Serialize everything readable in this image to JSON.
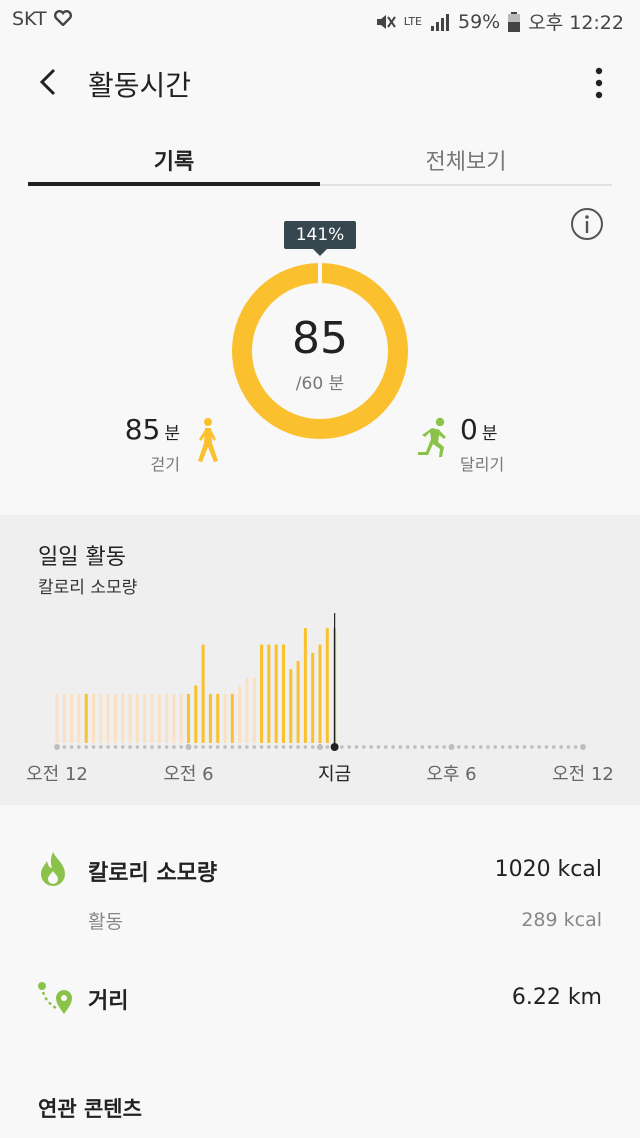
{
  "status_bar": {
    "carrier": "SKT",
    "battery": "59%",
    "time": "오후 12:22",
    "network": "LTE"
  },
  "header": {
    "title": "활동시간"
  },
  "tabs": [
    {
      "label": "기록",
      "active": true
    },
    {
      "label": "전체보기",
      "active": false
    }
  ],
  "summary": {
    "percent_badge": "141%",
    "minutes": "85",
    "goal": "/60 분",
    "progress": 1.41,
    "walk": {
      "value": "85",
      "unit": "분",
      "label": "걷기"
    },
    "run": {
      "value": "0",
      "unit": "분",
      "label": "달리기"
    }
  },
  "daily": {
    "title": "일일 활동",
    "subtitle": "칼로리 소모량",
    "chart_data": {
      "type": "bar",
      "x_labels": [
        "오전 12",
        "오전 6",
        "지금",
        "오후 6",
        "오전 12"
      ],
      "slots_total": 72,
      "now_slot": 38,
      "values": [
        6,
        6,
        6,
        6,
        6,
        6,
        6,
        6,
        6,
        6,
        6,
        6,
        6,
        6,
        6,
        6,
        6,
        6,
        6,
        7,
        12,
        6,
        6,
        6,
        6,
        7,
        8,
        8,
        12,
        12,
        12,
        12,
        9,
        10,
        14,
        11,
        12,
        14,
        14,
        0
      ],
      "active_flags": [
        0,
        0,
        0,
        0,
        1,
        0,
        0,
        0,
        0,
        0,
        0,
        0,
        0,
        0,
        0,
        0,
        0,
        0,
        1,
        1,
        1,
        1,
        1,
        0,
        1,
        0,
        0,
        0,
        1,
        1,
        1,
        1,
        1,
        1,
        1,
        1,
        1,
        1,
        1,
        0
      ],
      "colors": {
        "active": "#fbc02d",
        "inactive": "#fbe1c4",
        "dot": "#bdbdbd",
        "now": "#222222"
      }
    }
  },
  "details": {
    "calories": {
      "label": "칼로리 소모량",
      "value": "1020 kcal"
    },
    "active_calories": {
      "label": "활동",
      "value": "289 kcal"
    },
    "distance": {
      "label": "거리",
      "value": "6.22 km"
    }
  },
  "related": {
    "label": "연관 콘텐츠"
  },
  "colors": {
    "accent": "#fbc02d",
    "green": "#8bc34a",
    "badge": "#37474f"
  }
}
